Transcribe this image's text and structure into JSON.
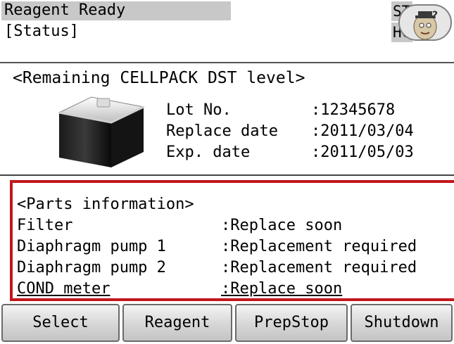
{
  "header": {
    "title": "Reagent Ready",
    "subtitle": "[Status]",
    "indicators": [
      "ST",
      "HC"
    ],
    "help_icon": "help-doctor-icon"
  },
  "reagent": {
    "title": "<Remaining CELLPACK DST level>",
    "bottle_icon": "reagent-bottle-icon",
    "rows": [
      {
        "label": "Lot No.",
        "value": ":12345678"
      },
      {
        "label": "Replace date",
        "value": ":2011/03/04"
      },
      {
        "label": "Exp. date",
        "value": ":2011/05/03"
      }
    ]
  },
  "parts": {
    "title": "<Parts information>",
    "highlight_color": "#c0161c",
    "rows": [
      {
        "name": "Filter",
        "status": ":Replace soon"
      },
      {
        "name": "Diaphragm pump 1",
        "status": ":Replacement required"
      },
      {
        "name": "Diaphragm pump 2",
        "status": ":Replacement required"
      },
      {
        "name": "COND meter",
        "status": ":Replace soon"
      }
    ]
  },
  "buttons": [
    "Select",
    "Reagent",
    "PrepStop",
    "Shutdown"
  ]
}
